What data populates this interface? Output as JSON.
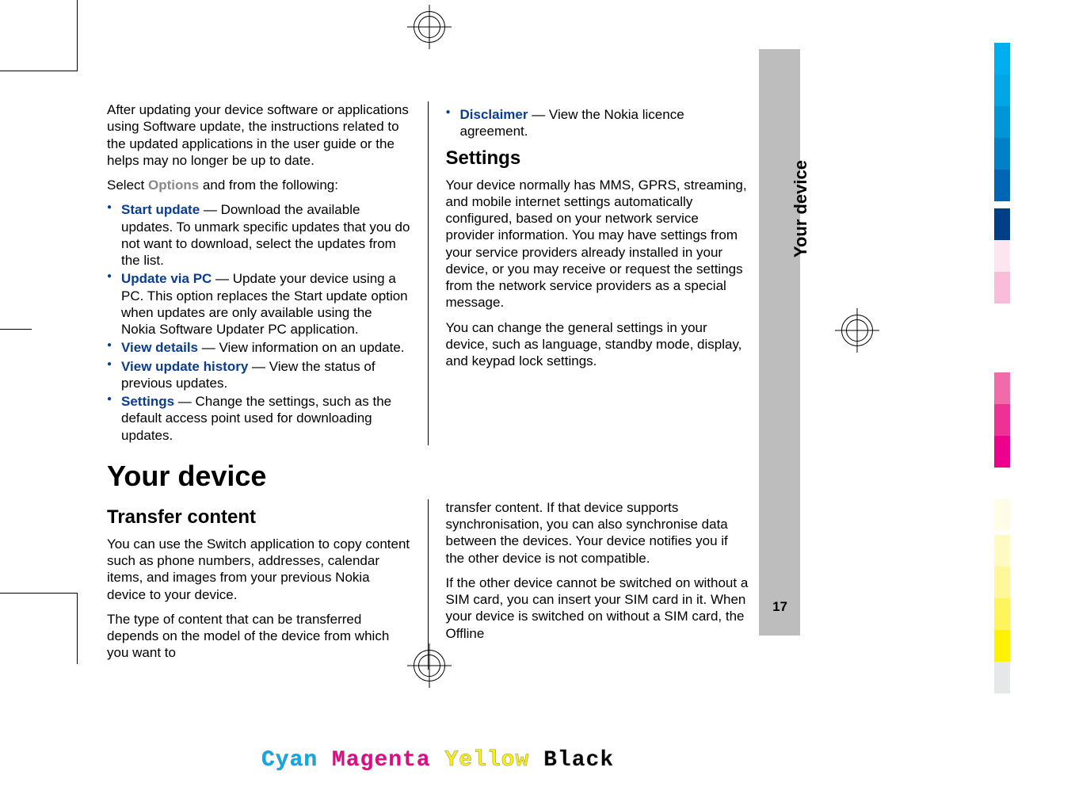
{
  "page_number": "17",
  "tab_label": "Your device",
  "col1": {
    "intro": "After updating your device software or applications using Software update, the instructions related to the updated applications in the user guide or the helps may no longer be up to date.",
    "select_line_a": "Select ",
    "select_line_b": "Options",
    "select_line_c": " and from the following:",
    "options": [
      {
        "name": "Start update",
        "desc": " — Download the available updates. To unmark specific updates that you do not want to download, select the updates from the list."
      },
      {
        "name": "Update via PC",
        "desc": " — Update your device using a PC. This option replaces the Start update option when updates are only available using the Nokia Software Updater PC application."
      },
      {
        "name": "View details",
        "desc": " — View information on an update."
      },
      {
        "name": "View update history",
        "desc": " — View the status of previous updates."
      },
      {
        "name": "Settings",
        "desc": " — Change the settings, such as the default access point used for downloading updates."
      }
    ]
  },
  "col2": {
    "disclaimer_name": "Disclaimer",
    "disclaimer_desc": " — View the Nokia licence agreement.",
    "settings_heading": "Settings",
    "settings_p1": "Your device normally has MMS, GPRS, streaming, and mobile internet settings automatically configured, based on your network service provider information. You may have settings from your service providers already installed in your device, or you may receive or request the settings from the network service providers as a special message.",
    "settings_p2": "You can change the general settings in your device, such as language, standby mode, display, and keypad lock settings."
  },
  "section_heading": "Your device",
  "transfer": {
    "heading": "Transfer content",
    "p1": "You can use the Switch application to copy content such as phone numbers, addresses, calendar items, and images from your previous Nokia device to your device.",
    "p2": "The type of content that can be transferred depends on the model of the device from which you want to",
    "p3": "transfer content. If that device supports synchronisation, you can also synchronise data between the devices. Your device notifies you if the other device is not compatible.",
    "p4": "If the other device cannot be switched on without a SIM card, you can insert your SIM card in it. When your device is switched on without a SIM card, the Offline"
  },
  "cmyk": {
    "c": "Cyan",
    "m": "Magenta",
    "y": "Yellow",
    "k": "Black"
  },
  "swatches1": [
    "#00aeef",
    "#00a5e3",
    "#0095d6",
    "#0081c6",
    "#0066b3",
    "#003f87"
  ],
  "swatches2": [
    "#fde6f0",
    "#fabdd9",
    "#f7941d00",
    "#f06ba8",
    "#ed3293",
    "#ec008c"
  ],
  "swatches3": [
    "#ffffff",
    "#fffde5",
    "#fffac2",
    "#fff799",
    "#fff45c",
    "#fff200"
  ],
  "swatches4": [
    "#e6e7e8",
    "#cccccc",
    "#b3b3b3",
    "#999999",
    "#666666",
    "#000000"
  ]
}
